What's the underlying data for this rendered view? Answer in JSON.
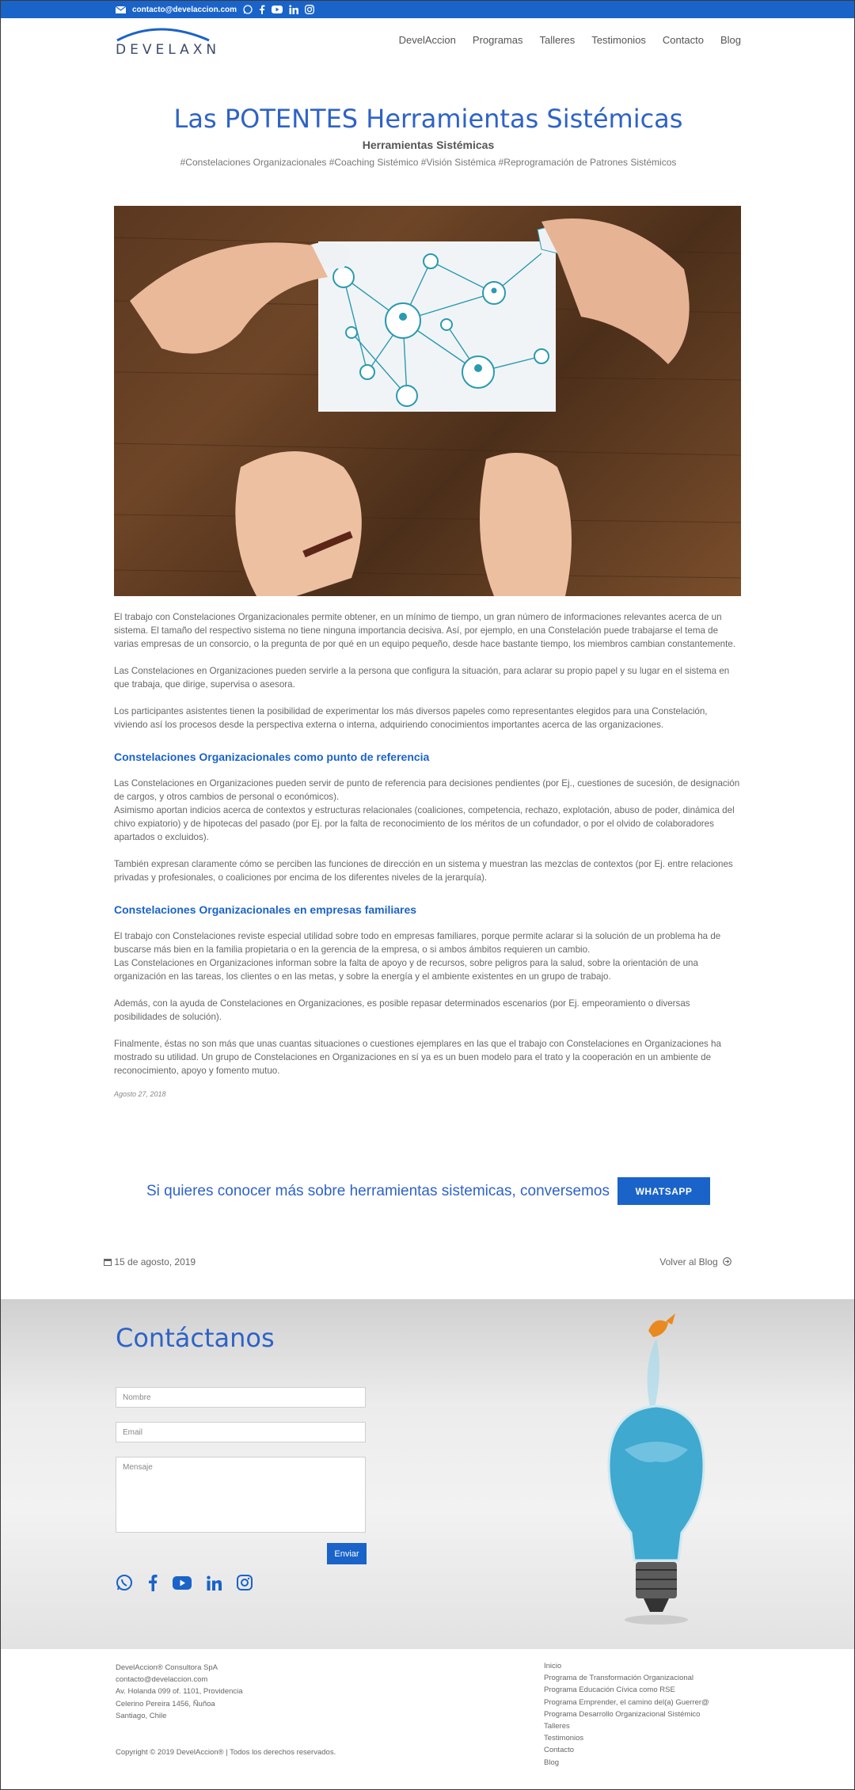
{
  "topbar": {
    "email": "contacto@develaccion.com"
  },
  "brand": {
    "logo_text": "DEVELAXN",
    "accent": "#1a63c9"
  },
  "nav": {
    "items": [
      "DevelAccion",
      "Programas",
      "Talleres",
      "Testimonios",
      "Contacto",
      "Blog"
    ]
  },
  "hero": {
    "title": "Las POTENTES Herramientas Sistémicas",
    "subtitle": "Herramientas Sistémicas",
    "tags": "#Constelaciones Organizacionales #Coaching Sistémico #Visión Sistémica #Reprogramación de Patrones Sistémicos"
  },
  "article": {
    "p1": "El trabajo con Constelaciones Organizacionales permite obtener, en un mínimo de tiempo, un gran número de informaciones relevantes acerca de un sistema. El tamaño del respectivo sistema no tiene ninguna importancia decisiva. Así, por ejemplo, en una Constelación puede trabajarse el tema de varias empresas de un consorcio, o la pregunta de por qué en un equipo pequeño, desde hace bastante tiempo, los miembros cambian constantemente.",
    "p2": "Las Constelaciones en Organizaciones pueden servirle a la persona que configura la situación, para aclarar su propio papel y su lugar en el sistema en que trabaja, que dirige, supervisa o asesora.",
    "p3": "Los participantes asistentes tienen la posibilidad de experimentar los más diversos papeles como representantes elegidos para una Constelación, viviendo así los procesos desde la perspectiva externa o interna, adquiriendo conocimientos importantes acerca de las organizaciones.",
    "h1": "Constelaciones Organizacionales como punto de referencia",
    "p4a": "Las Constelaciones en Organizaciones pueden servir de punto de referencia para decisiones pendientes (por Ej., cuestiones de sucesión, de designación de cargos, y otros cambios de personal o económicos).",
    "p4b": "Asimismo aportan indicios acerca de contextos y estructuras relacionales (coaliciones, competencia, rechazo, explotación, abuso de poder, dinámica del chivo expiatorio) y de hipotecas del pasado (por Ej. por la falta de reconocimiento de los méritos de un cofundador, o por el olvido de colaboradores apartados o excluidos).",
    "p5": "También expresan claramente cómo se perciben las funciones de dirección en un sistema y muestran las mezclas de contextos (por Ej. entre relaciones privadas y profesionales, o coaliciones por encima de los diferentes niveles de la jerarquía).",
    "h2": "Constelaciones Organizacionales en empresas familiares",
    "p6a": "El trabajo con Constelaciones reviste especial utilidad sobre todo en empresas familiares, porque permite aclarar si la solución de un problema ha de buscarse más bien en la familia propietaria o en la gerencia de la empresa, o si ambos ámbitos requieren un cambio.",
    "p6b": "Las Constelaciones en Organizaciones informan sobre la falta de apoyo y de recursos, sobre peligros para la salud, sobre la orientación de una organización en las tareas, los clientes o en las metas, y sobre la energía y el ambiente existentes en un grupo de trabajo.",
    "p7": "Además, con la ayuda de Constelaciones en Organizaciones, es posible repasar determinados escenarios (por Ej. empeoramiento o diversas posibilidades de solución).",
    "p8": "Finalmente, éstas no son más que unas cuantas situaciones o cuestiones ejemplares en las que el trabajo con Constelaciones en Organizaciones ha mostrado su utilidad. Un grupo de Constelaciones en Organizaciones en sí ya es un buen modelo para el trato y la cooperación en un ambiente de reconocimiento, apoyo y fomento mutuo.",
    "date": "Agosto 27, 2018"
  },
  "cta": {
    "text": "Si quieres conocer más sobre herramientas sistemicas, conversemos",
    "button": "WHATSAPP"
  },
  "postnav": {
    "date": "15 de agosto, 2019",
    "back": "Volver al Blog"
  },
  "contact": {
    "title": "Contáctanos",
    "name_placeholder": "Nombre",
    "email_placeholder": "Email",
    "message_placeholder": "Mensaje",
    "submit": "Enviar"
  },
  "footer": {
    "company": "DevelAccion® Consultora SpA",
    "email": "contacto@develaccion.com",
    "address1": "Av. Holanda 099 of. 1101, Providencia",
    "address2": "Celerino Pereira 1456, Ñuñoa",
    "city": "Santiago, Chile",
    "copyright": "Copyright © 2019 DevelAccion® | Todos los derechos reservados.",
    "links": [
      "Inicio",
      "Programa de Transformación Organizacional",
      "Programa Educación Cívica como RSE",
      "Programa Emprender, el camino del(a) Guerrer@",
      "Programa Desarrollo Organizacional Sistémico",
      "Talleres",
      "Testimonios",
      "Contacto",
      "Blog"
    ]
  }
}
